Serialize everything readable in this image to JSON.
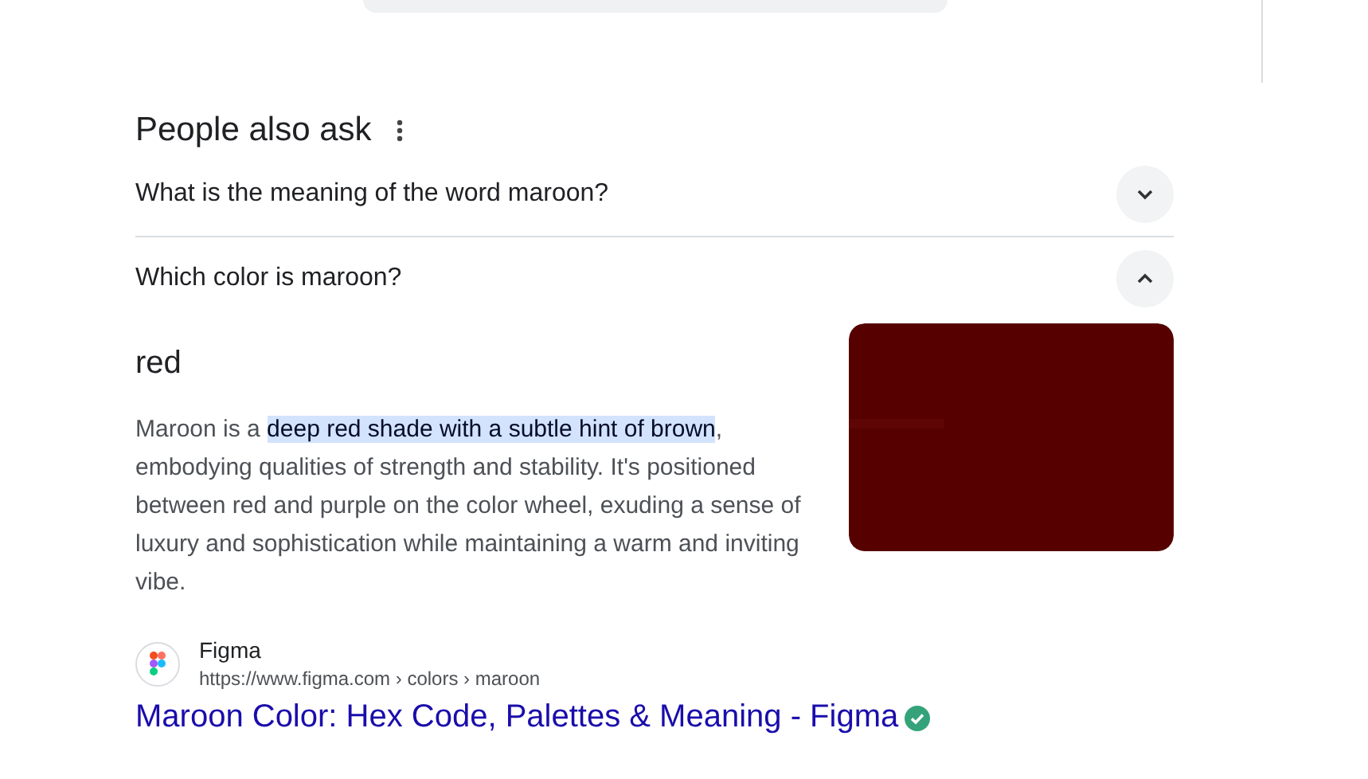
{
  "section_title": "People also ask",
  "questions": [
    {
      "text": "What is the meaning of the word maroon?",
      "expanded": false
    },
    {
      "text": "Which color is maroon?",
      "expanded": true
    }
  ],
  "answer": {
    "heading": "red",
    "snippet": "Maroon is a **deep red shade with a subtle hint of brown**, embodying qualities of strength and stability. It's positioned between red and purple on the color wheel, exuding a sense of luxury and sophistication while maintaining a warm and inviting vibe."
  },
  "source": {
    "site": "Figma",
    "url": "https://www.figma.com › colors › maroon",
    "title": "Maroon Color: Hex Code, Palettes & Meaning - Figma",
    "verified": true
  }
}
